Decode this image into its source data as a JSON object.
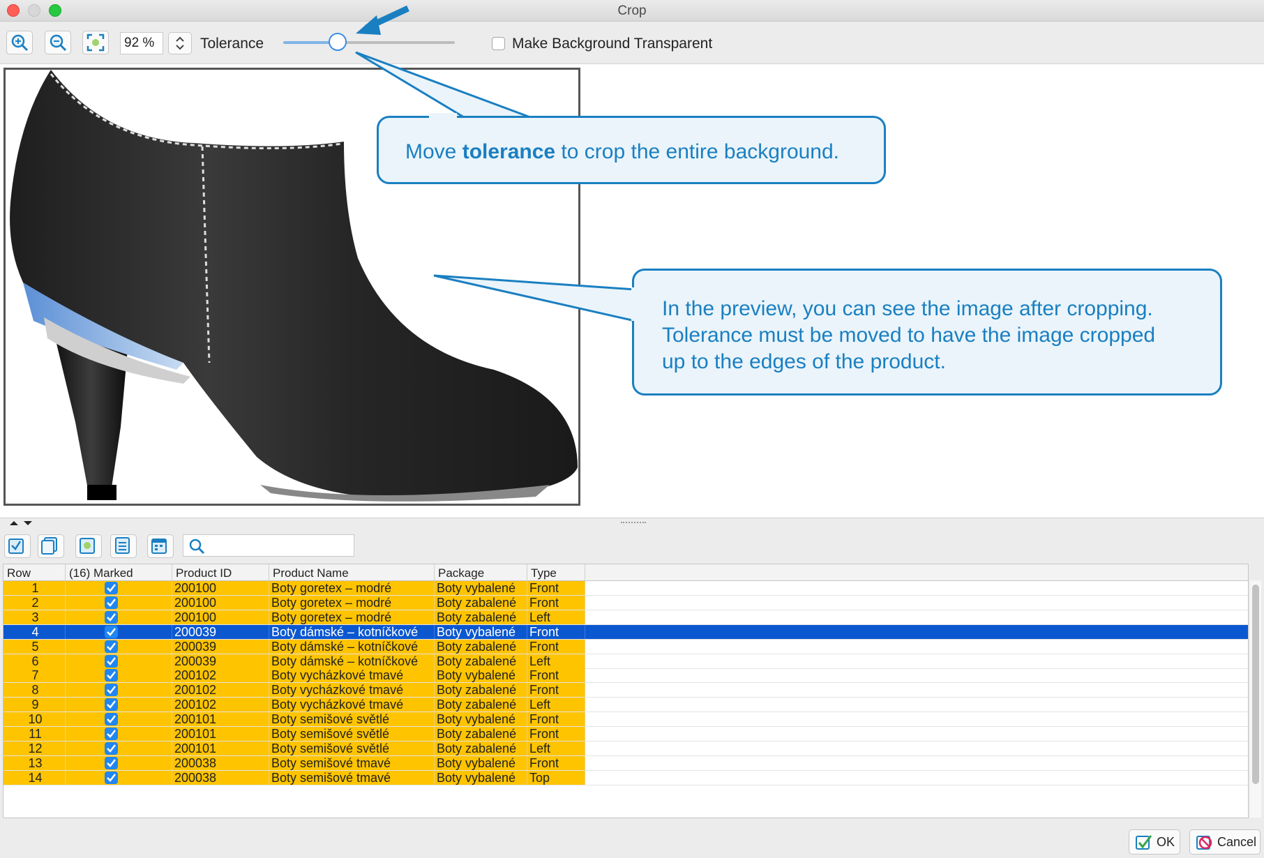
{
  "window": {
    "title": "Crop"
  },
  "toolbar": {
    "zoom_value": "92 %",
    "tolerance_label": "Tolerance",
    "tolerance_level": 0.32,
    "transparent_label": "Make Background Transparent",
    "transparent_checked": false
  },
  "callouts": {
    "first_before": "Move ",
    "first_bold": "tolerance",
    "first_after": " to crop the entire background.",
    "second_lines": [
      "In the preview, you can see the image after cropping.",
      "Tolerance must be moved to have the image cropped",
      "up to the edges of the product."
    ],
    "color": "#1a7fc1"
  },
  "table": {
    "columns": [
      "Row",
      "(16) Marked",
      "Product ID",
      "Product Name",
      "Package",
      "Type"
    ],
    "rows": [
      {
        "row": "1",
        "marked": true,
        "id": "200100",
        "name": "Boty goretex – modré",
        "package": "Boty vybalené",
        "type": "Front"
      },
      {
        "row": "2",
        "marked": true,
        "id": "200100",
        "name": "Boty goretex – modré",
        "package": "Boty zabalené",
        "type": "Front"
      },
      {
        "row": "3",
        "marked": true,
        "id": "200100",
        "name": "Boty goretex – modré",
        "package": "Boty zabalené",
        "type": "Left"
      },
      {
        "row": "4",
        "marked": true,
        "id": "200039",
        "name": "Boty dámské – kotníčkové",
        "package": "Boty vybalené",
        "type": "Front"
      },
      {
        "row": "5",
        "marked": true,
        "id": "200039",
        "name": "Boty dámské – kotníčkové",
        "package": "Boty zabalené",
        "type": "Front"
      },
      {
        "row": "6",
        "marked": true,
        "id": "200039",
        "name": "Boty dámské – kotníčkové",
        "package": "Boty zabalené",
        "type": "Left"
      },
      {
        "row": "7",
        "marked": true,
        "id": "200102",
        "name": "Boty vycházkové tmavé",
        "package": "Boty vybalené",
        "type": "Front"
      },
      {
        "row": "8",
        "marked": true,
        "id": "200102",
        "name": "Boty vycházkové tmavé",
        "package": "Boty zabalené",
        "type": "Front"
      },
      {
        "row": "9",
        "marked": true,
        "id": "200102",
        "name": "Boty vycházkové tmavé",
        "package": "Boty zabalené",
        "type": "Left"
      },
      {
        "row": "10",
        "marked": true,
        "id": "200101",
        "name": "Boty semišové světlé",
        "package": "Boty vybalené",
        "type": "Front"
      },
      {
        "row": "11",
        "marked": true,
        "id": "200101",
        "name": "Boty semišové světlé",
        "package": "Boty zabalené",
        "type": "Front"
      },
      {
        "row": "12",
        "marked": true,
        "id": "200101",
        "name": "Boty semišové světlé",
        "package": "Boty zabalené",
        "type": "Left"
      },
      {
        "row": "13",
        "marked": true,
        "id": "200038",
        "name": "Boty semišové tmavé",
        "package": "Boty vybalené",
        "type": "Front"
      },
      {
        "row": "14",
        "marked": true,
        "id": "200038",
        "name": "Boty semišové tmavé",
        "package": "Boty vybalené",
        "type": "Top"
      }
    ],
    "selected_row": "4",
    "row_color": "#fec400",
    "selected_color": "#0b57d0"
  },
  "buttons": {
    "ok": "OK",
    "cancel": "Cancel"
  },
  "icons": [
    "zoom-in-icon",
    "zoom-out-icon",
    "fit-icon",
    "mark-all-icon",
    "unmark-icon",
    "add-icon",
    "list-icon",
    "calendar-icon",
    "search-icon",
    "check-icon",
    "cancel-icon"
  ]
}
